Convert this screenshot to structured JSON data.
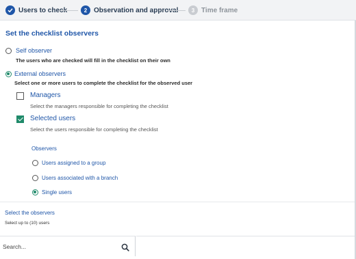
{
  "stepper": {
    "steps": [
      {
        "number": "1",
        "label": "Users to check",
        "state": "done"
      },
      {
        "number": "2",
        "label": "Observation and approval",
        "state": "active"
      },
      {
        "number": "3",
        "label": "Time frame",
        "state": "pending"
      }
    ],
    "done_icon": "check-icon"
  },
  "section": {
    "title": "Set the checklist observers"
  },
  "observer_type": {
    "self": {
      "label": "Self observer",
      "description": "The users who are checked will fill in the checklist on their own",
      "selected": false
    },
    "external": {
      "label": "External observers",
      "description": "Select one or more users to complete the checklist for the observed user",
      "selected": true
    }
  },
  "external_options": {
    "managers": {
      "label": "Managers",
      "description": "Select the managers responsible for completing the checklist",
      "checked": false
    },
    "selected_users": {
      "label": "Selected users",
      "description": "Select the users responsible for completing the checklist",
      "checked": true
    }
  },
  "observers": {
    "title": "Observers",
    "options": [
      {
        "label": "Users assigned to a group",
        "selected": false
      },
      {
        "label": "Users associated with a branch",
        "selected": false
      },
      {
        "label": "Single users",
        "selected": true
      }
    ]
  },
  "select_observers": {
    "title": "Select the observers",
    "description": "Select up to (10) users"
  },
  "search": {
    "placeholder": "Search...",
    "icon": "search-icon"
  },
  "colors": {
    "accent": "#1f56a8",
    "selected": "#1f8a6a",
    "stepper_bg": "#f2f3f5"
  }
}
